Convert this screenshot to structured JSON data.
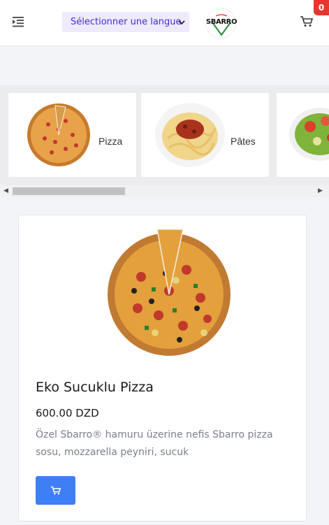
{
  "header": {
    "language_select": "Sélectionner une langue",
    "logo_text": "SBARRO",
    "cart_count": "0"
  },
  "categories": [
    {
      "label": "Pizza"
    },
    {
      "label": "Pâtes"
    },
    {
      "label": ""
    }
  ],
  "product": {
    "name": "Eko Sucuklu Pizza",
    "price": "600.00 DZD",
    "description": "Özel Sbarro® hamuru üzerine nefis Sbarro pizza sosu, mozzarella peyniri, sucuk"
  },
  "colors": {
    "accent": "#3e7ff5",
    "badge": "#e8352e",
    "language_bg": "#efeafd"
  }
}
